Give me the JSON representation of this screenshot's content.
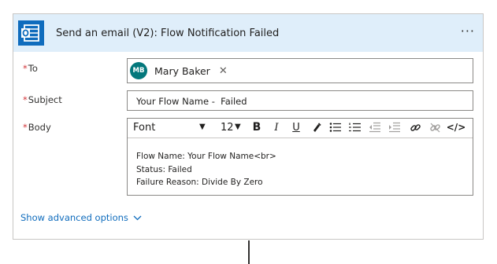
{
  "action": {
    "title": "Send an email (V2): Flow Notification Failed",
    "app_icon": "outlook-icon",
    "more_icon": "more-options-icon",
    "more_glyph": "···",
    "accent_color": "#dfeefa"
  },
  "fields": {
    "to": {
      "label": "To",
      "required_mark": "*",
      "recipient": {
        "initials": "MB",
        "name": "Mary Baker",
        "remove_glyph": "✕"
      }
    },
    "subject": {
      "label": "Subject",
      "required_mark": "*",
      "value": "Your Flow Name -  Failed"
    },
    "body": {
      "label": "Body",
      "required_mark": "*",
      "toolbar": {
        "font": "Font",
        "size": "12",
        "caret": "▼",
        "bold": "B",
        "italic": "I",
        "underline": "U",
        "code_view": "</>"
      },
      "lines": [
        "Flow Name: Your Flow Name<br>",
        "Status: Failed",
        "Failure Reason: Divide By Zero"
      ]
    }
  },
  "advanced": {
    "label": "Show advanced options"
  }
}
